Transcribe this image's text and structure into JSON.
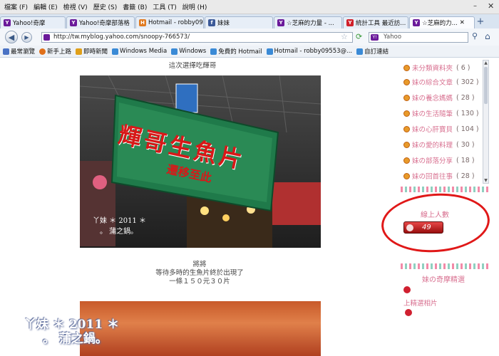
{
  "menu": [
    "檔案 (F)",
    "編輯 (E)",
    "檢視 (V)",
    "歷史 (S)",
    "書籤 (B)",
    "工具 (T)",
    "說明 (H)"
  ],
  "tabs": [
    {
      "label": "Yahoo!奇摩",
      "icon": "Y!",
      "color": "#6b1a9a"
    },
    {
      "label": "Yahoo!奇摩部落格",
      "icon": "Y!",
      "color": "#6b1a9a"
    },
    {
      "label": "Hotmail - robby095...",
      "icon": "H",
      "color": "#e07a20"
    },
    {
      "label": "妹妹",
      "icon": "f",
      "color": "#3b5998"
    },
    {
      "label": "☆芝麻的力量 - ...",
      "icon": "Y!",
      "color": "#6b1a9a"
    },
    {
      "label": "統計工具 最近訪...",
      "icon": "Y!",
      "color": "#d0202a"
    },
    {
      "label": "☆芝麻的力...",
      "icon": "Y!",
      "color": "#6b1a9a"
    }
  ],
  "url": "http://tw.myblog.yahoo.com/snoopy-766573/",
  "search": {
    "placeholder": "Yahoo"
  },
  "bookmarks": [
    {
      "label": "最常瀏覽",
      "color": "#4a72c4"
    },
    {
      "label": "新手上路",
      "color": "#e0701a"
    },
    {
      "label": "即時新聞",
      "color": "#e0a01a"
    },
    {
      "label": "Windows Media",
      "color": "#3a8ad6"
    },
    {
      "label": "Windows",
      "color": "#3a8ad6"
    },
    {
      "label": "免費的 Hotmail",
      "color": "#3a8ad6"
    },
    {
      "label": "Hotmail - robby09553@...",
      "color": "#3a8ad6"
    },
    {
      "label": "自訂連結",
      "color": "#3a8ad6"
    }
  ],
  "post": {
    "caption_top": "這次選擇吃輝哥",
    "banner_sign": "輝哥生魚片",
    "banner_sub": "遷移至此",
    "lines": [
      "將將",
      "等待多時的生魚片終於出現了",
      "一條１５０元３０片"
    ],
    "watermark_line1": "丫妹 ＊ 2011 ＊",
    "watermark_line2": "。 蒲之鍋。"
  },
  "sidebar": {
    "items": [
      {
        "label": "未分類資料夾",
        "count": "( 6 )"
      },
      {
        "label": "妹の綜合文章",
        "count": "( 302 )"
      },
      {
        "label": "妹の養念媽媽",
        "count": "( 28 )"
      },
      {
        "label": "妹の生活隨筆",
        "count": "( 130 )"
      },
      {
        "label": "妹の心肝寶貝",
        "count": "( 104 )"
      },
      {
        "label": "妹の愛的料理",
        "count": "( 30 )"
      },
      {
        "label": "妹の部落分享",
        "count": "( 18 )"
      },
      {
        "label": "妹の回首往事",
        "count": "( 28 )"
      }
    ],
    "online_title": "線上人數",
    "online_count": "49",
    "section_title": "妹の奇摩精選",
    "link": "上精選相片"
  },
  "footer_watermark": {
    "line1": "丫妹 ＊ 2011 ＊",
    "line2": "。 蒲之鍋。"
  }
}
